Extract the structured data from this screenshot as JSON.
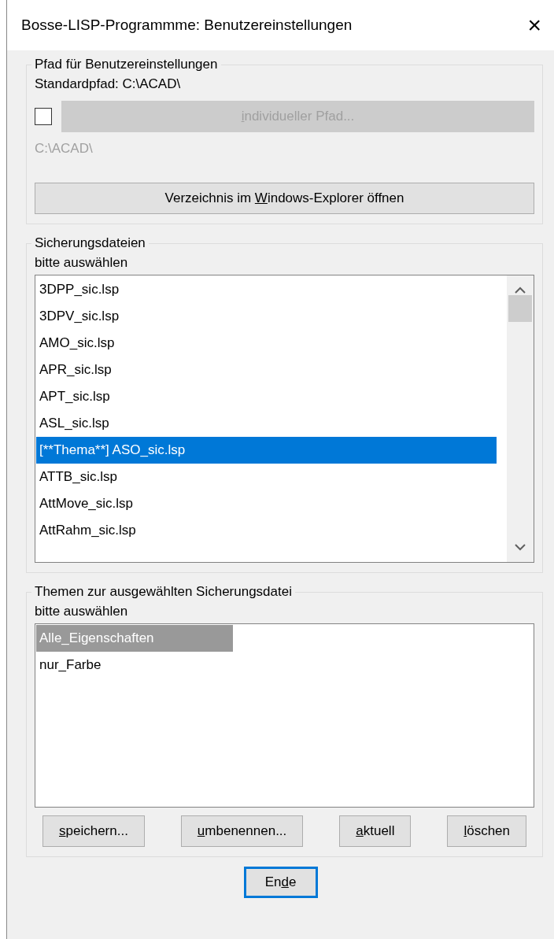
{
  "window": {
    "title": "Bosse-LISP-Programmme: Benutzereinstellungen",
    "close": "×"
  },
  "path_group": {
    "title": "Pfad für Benutzereinstellungen",
    "standard_path": "Standardpfad: C:\\ACAD\\",
    "custom_checkbox": {
      "checked": false
    },
    "custom_button": {
      "label": {
        "key": "i",
        "post": "ndividueller Pfad..."
      },
      "disabled": true
    },
    "custom_path": {
      "text": "C:\\ACAD\\",
      "disabled": true
    },
    "explorer_button": {
      "label": {
        "pre": "Verzeichnis im ",
        "key": "W",
        "post": "indows-Explorer öffnen"
      },
      "disabled": false
    }
  },
  "backups_group": {
    "title": "Sicherungsdateien",
    "hint": "bitte auswählen",
    "focused": true,
    "items": [
      {
        "label": "3DPP_sic.lsp",
        "selected": false
      },
      {
        "label": "3DPV_sic.lsp",
        "selected": false
      },
      {
        "label": "AMO_sic.lsp",
        "selected": false
      },
      {
        "label": "APR_sic.lsp",
        "selected": false
      },
      {
        "label": "APT_sic.lsp",
        "selected": false
      },
      {
        "label": "ASL_sic.lsp",
        "selected": false
      },
      {
        "label": "[**Thema**] ASO_sic.lsp",
        "selected": true
      },
      {
        "label": "ATTB_sic.lsp",
        "selected": false
      },
      {
        "label": "AttMove_sic.lsp",
        "selected": false
      },
      {
        "label": "AttRahm_sic.lsp",
        "selected": false
      }
    ]
  },
  "themes_group": {
    "title": "Themen zur ausgewählten Sicherungsdatei",
    "hint": "bitte auswählen",
    "focused": false,
    "items": [
      {
        "label": "Alle_Eigenschaften",
        "selected": true
      },
      {
        "label": "nur_Farbe",
        "selected": false
      }
    ],
    "buttons": [
      {
        "label": {
          "key": "s",
          "post": "peichern..."
        }
      },
      {
        "label": {
          "key": "u",
          "post": "mbenennen..."
        }
      },
      {
        "label": {
          "key": "a",
          "post": "ktuell"
        }
      },
      {
        "label": {
          "key": "l",
          "post": "öschen"
        }
      }
    ]
  },
  "end_button": {
    "label": {
      "pre": "En",
      "key": "d",
      "post": "e"
    },
    "default": true
  }
}
